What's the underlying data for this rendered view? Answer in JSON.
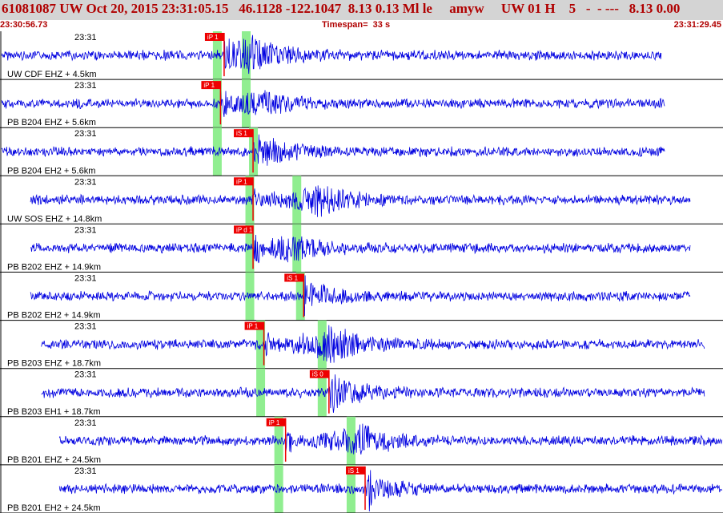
{
  "header": {
    "title": "61081087 UW Oct 20, 2015 23:31:05.15   46.1128 -122.1047  8.13 0.13 Ml le     amyw     UW 01 H    5   -  - ---   8.13 0.00",
    "start_time": "23:30:56.73",
    "timespan": "Timespan=  33 s",
    "end_time": "23:31:29.45"
  },
  "colors": {
    "trace": "#0000e0",
    "pick": "#ee0000",
    "window": "#90ee90",
    "grid": "#000000",
    "title": "#b00000"
  },
  "traces": [
    {
      "time_label": "23:31",
      "station": "UW CDF EHZ + 4.5km",
      "pick": "iP 1",
      "amp": 0.9,
      "noise_start": 0.0,
      "noise_end": 0.915,
      "onset": 0.31,
      "burst": 0.35,
      "windows": [
        0.3,
        0.34
      ]
    },
    {
      "time_label": "23:31",
      "station": "PB B204 EHZ + 5.6km",
      "pick": "iP 1",
      "amp": 0.6,
      "noise_start": 0.0,
      "noise_end": 0.92,
      "onset": 0.305,
      "burst": 0.36,
      "windows": [
        0.3,
        0.34
      ]
    },
    {
      "time_label": "23:31",
      "station": "PB B204 EH2 + 5.6km",
      "pick": "iS 1",
      "amp": 0.6,
      "noise_start": 0.0,
      "noise_end": 0.92,
      "onset": 0.35,
      "burst": 0.37,
      "windows": [
        0.3,
        0.35
      ]
    },
    {
      "time_label": "23:31",
      "station": "UW SOS EHZ + 14.8km",
      "pick": "iP 1",
      "amp": 0.8,
      "noise_start": 0.04,
      "noise_end": 0.955,
      "onset": 0.35,
      "burst": 0.44,
      "windows": [
        0.345,
        0.41
      ]
    },
    {
      "time_label": "23:31",
      "station": "PB B202 EHZ + 14.9km",
      "pick": "iP d 1",
      "amp": 0.6,
      "noise_start": 0.04,
      "noise_end": 0.955,
      "onset": 0.35,
      "burst": 0.4,
      "windows": [
        0.345,
        0.41
      ]
    },
    {
      "time_label": "23:31",
      "station": "PB B202 EH2 + 14.9km",
      "pick": "iS 1",
      "amp": 0.6,
      "noise_start": 0.04,
      "noise_end": 0.955,
      "onset": 0.42,
      "burst": 0.43,
      "windows": [
        0.345,
        0.415
      ]
    },
    {
      "time_label": "23:31",
      "station": "PB B203 EHZ + 18.7km",
      "pick": "iP 1",
      "amp": 0.9,
      "noise_start": 0.055,
      "noise_end": 0.975,
      "onset": 0.365,
      "burst": 0.46,
      "windows": [
        0.36,
        0.445
      ]
    },
    {
      "time_label": "23:31",
      "station": "PB B203 EH1 + 18.7km",
      "pick": "iS 0",
      "amp": 0.6,
      "noise_start": 0.055,
      "noise_end": 0.975,
      "onset": 0.455,
      "burst": 0.465,
      "windows": [
        0.36,
        0.445
      ]
    },
    {
      "time_label": "23:31",
      "station": "PB B201 EHZ + 24.5km",
      "pick": "iP 1",
      "amp": 0.8,
      "noise_start": 0.08,
      "noise_end": 1.0,
      "onset": 0.395,
      "burst": 0.5,
      "windows": [
        0.385,
        0.485
      ]
    },
    {
      "time_label": "23:31",
      "station": "PB B201 EH2 + 24.5km",
      "pick": "iS 1",
      "amp": 0.6,
      "noise_start": 0.08,
      "noise_end": 1.0,
      "onset": 0.505,
      "burst": 0.51,
      "windows": [
        0.385,
        0.485
      ]
    }
  ]
}
